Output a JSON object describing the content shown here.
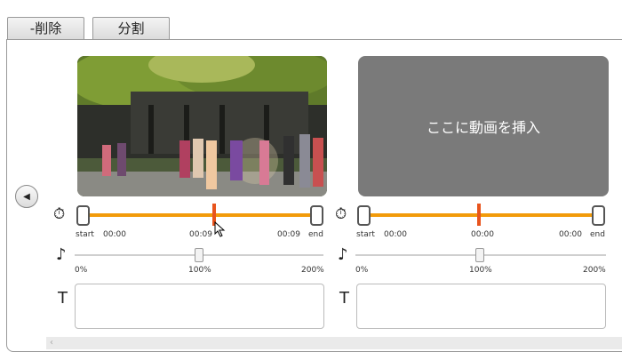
{
  "tabs": [
    {
      "label": "-削除"
    },
    {
      "label": "分割"
    }
  ],
  "clip1": {
    "time_current": "00:09",
    "time_start": "00:00",
    "time_end": "00:09",
    "start_label": "start",
    "end_label": "end",
    "speed_min": "0%",
    "speed_mid": "100%",
    "speed_max": "200%",
    "playhead_fraction": 0.56,
    "speed_value_fraction": 0.5
  },
  "clip2": {
    "placeholder": "ここに動画を挿入",
    "time_current": "00:00",
    "time_start": "00:00",
    "time_end": "00:00",
    "start_label": "start",
    "end_label": "end",
    "speed_min": "0%",
    "speed_mid": "100%",
    "speed_max": "200%",
    "playhead_fraction": 0.5,
    "speed_value_fraction": 0.5
  },
  "icons": {
    "prev": "triangle-left",
    "timer": "stopwatch",
    "speed": "music-note",
    "text": "T"
  },
  "colors": {
    "track": "#f29b0a",
    "playhead": "#e8541d",
    "empty_slot": "#7a7a7a"
  }
}
